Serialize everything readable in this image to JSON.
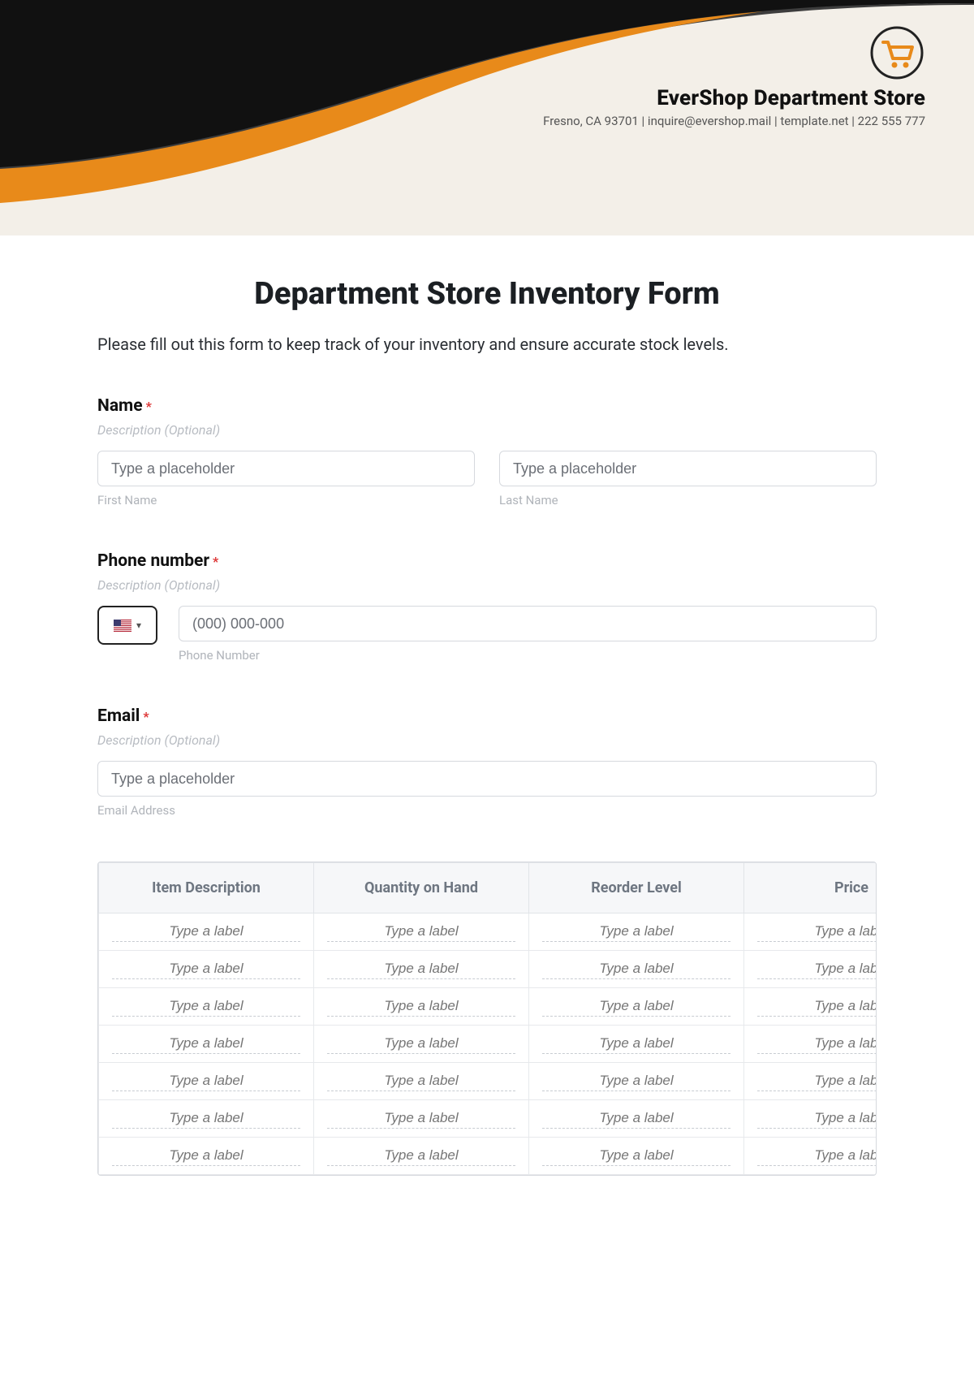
{
  "header": {
    "company_name": "EverShop Department Store",
    "contact_line": "Fresno, CA 93701 | inquire@evershop.mail | template.net | 222 555 777"
  },
  "form": {
    "title": "Department Store Inventory Form",
    "intro": "Please fill out this form to keep track of your inventory and ensure accurate stock levels.",
    "name": {
      "label": "Name",
      "required_mark": "*",
      "description": "Description (Optional)",
      "first_placeholder": "Type a placeholder",
      "first_sub": "First Name",
      "last_placeholder": "Type a placeholder",
      "last_sub": "Last Name"
    },
    "phone": {
      "label": "Phone number",
      "required_mark": "*",
      "description": "Description (Optional)",
      "placeholder": "(000) 000-000",
      "sub": "Phone Number"
    },
    "email": {
      "label": "Email",
      "required_mark": "*",
      "description": "Description (Optional)",
      "placeholder": "Type a placeholder",
      "sub": "Email Address"
    },
    "table": {
      "headers": [
        "Item Description",
        "Quantity on Hand",
        "Reorder Level",
        "Price"
      ],
      "cell_placeholder": "Type a label",
      "row_count": 7
    }
  }
}
